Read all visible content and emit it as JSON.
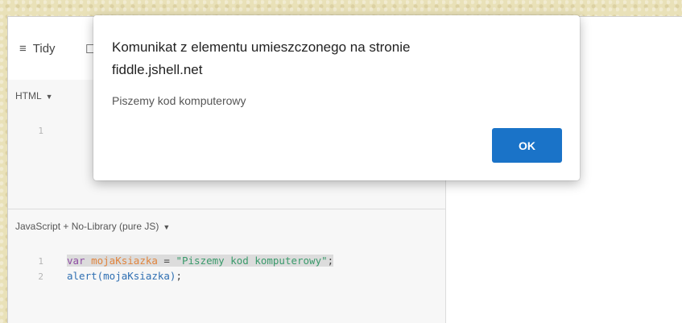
{
  "toolbar": {
    "tidy_icon": "list-lines-icon",
    "tidy_label": "Tidy",
    "collab_icon": "chat-bubble-icon",
    "collab_glyph": "☐"
  },
  "html_pane": {
    "label": "HTML",
    "line_numbers": [
      "1"
    ]
  },
  "js_pane": {
    "label": "JavaScript + No-Library (pure JS)",
    "line_numbers": [
      "1",
      "2"
    ],
    "line1": {
      "keyword": "var",
      "space": " ",
      "variable": "mojaKsiazka",
      "operator": " = ",
      "string": "\"Piszemy kod komputerowy\"",
      "end": ";"
    },
    "line2": {
      "func": "alert(mojaKsiazka)",
      "end": ";"
    }
  },
  "dialog": {
    "title_line1": "Komunikat z elementu umieszczonego na stronie",
    "title_line2": "fiddle.jshell.net",
    "message": "Piszemy kod komputerowy",
    "ok_label": "OK"
  },
  "colors": {
    "ok_button": "#1a73c8",
    "keyword": "#8e4da3",
    "variable": "#e0843d",
    "string": "#3a9a6b",
    "function": "#2f6fb2"
  }
}
